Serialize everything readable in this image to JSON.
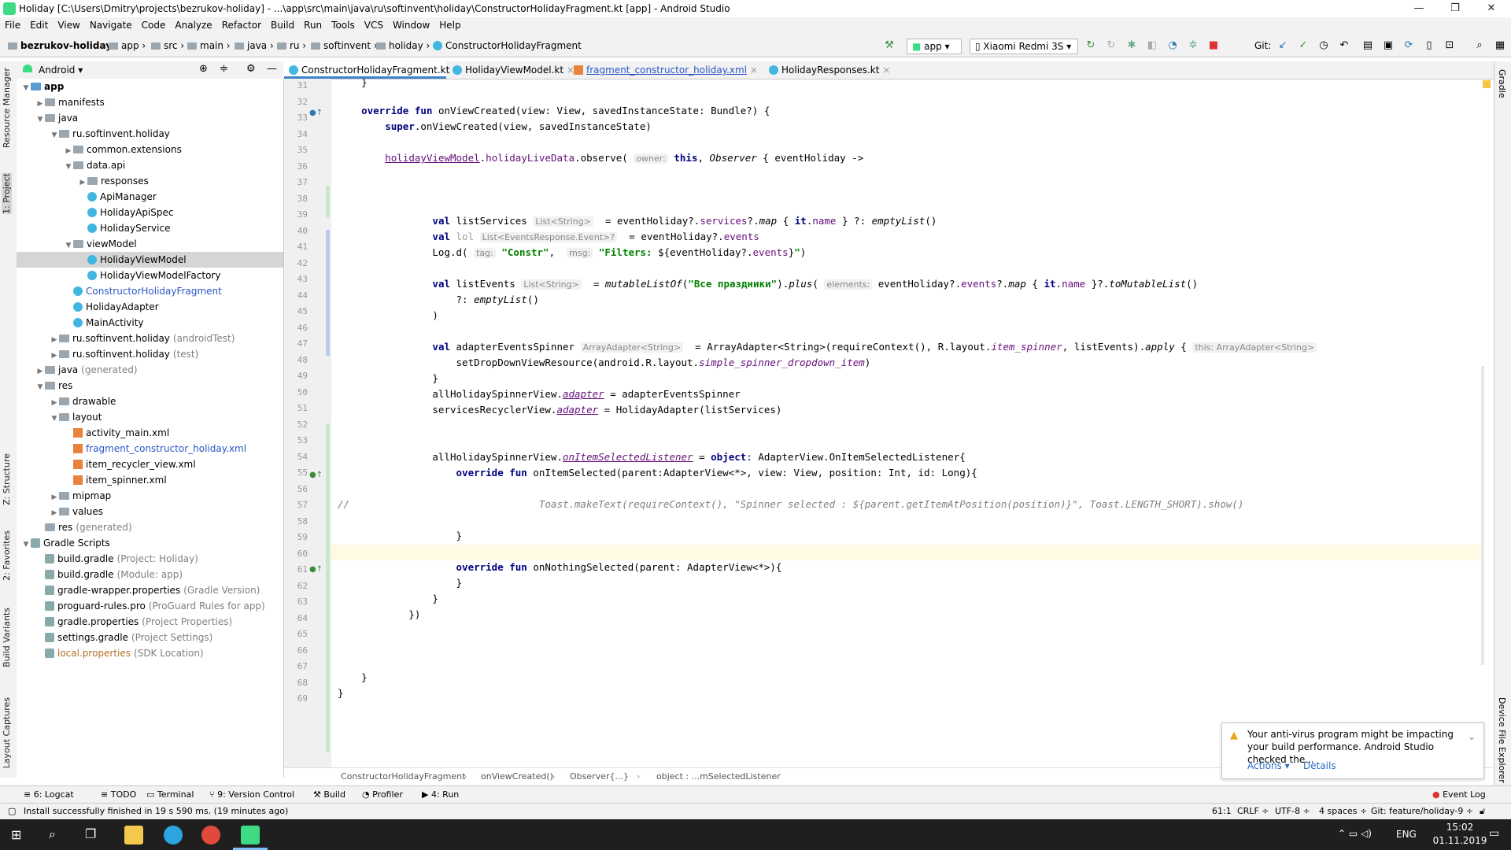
{
  "window": {
    "title": "Holiday [C:\\Users\\Dmitry\\projects\\bezrukov-holiday] - ...\\app\\src\\main\\java\\ru\\softinvent\\holiday\\ConstructorHolidayFragment.kt [app] - Android Studio",
    "minimize": "—",
    "maximize": "❐",
    "close": "✕"
  },
  "menu": [
    "File",
    "Edit",
    "View",
    "Navigate",
    "Code",
    "Analyze",
    "Refactor",
    "Build",
    "Run",
    "Tools",
    "VCS",
    "Window",
    "Help"
  ],
  "breadcrumbs": [
    "bezrukov-holiday",
    "app",
    "src",
    "main",
    "java",
    "ru",
    "softinvent",
    "holiday",
    "ConstructorHolidayFragment"
  ],
  "toolbar": {
    "run_config": "app",
    "device": "Xiaomi Redmi 3S",
    "git_label": "Git:"
  },
  "project_panel": {
    "view_mode": "Android"
  },
  "left_tabs": [
    "Resource Manager",
    "1: Project",
    "Z: Structure",
    "2: Favorites",
    "Build Variants",
    "Layout Captures"
  ],
  "right_tabs": [
    "Gradle",
    "Device File Explorer"
  ],
  "tree": [
    {
      "label": "app",
      "suffix": "",
      "icon": "folder"
    },
    {
      "label": "manifests",
      "suffix": "",
      "icon": "folder"
    },
    {
      "label": "java",
      "suffix": "",
      "icon": "folder"
    },
    {
      "label": "ru.softinvent.holiday",
      "suffix": "",
      "icon": "package"
    },
    {
      "label": "common.extensions",
      "suffix": "",
      "icon": "package"
    },
    {
      "label": "data.api",
      "suffix": "",
      "icon": "package"
    },
    {
      "label": "responses",
      "suffix": "",
      "icon": "package"
    },
    {
      "label": "ApiManager",
      "suffix": "",
      "icon": "kotlin-class"
    },
    {
      "label": "HolidayApiSpec",
      "suffix": "",
      "icon": "kotlin-class"
    },
    {
      "label": "HolidayService",
      "suffix": "",
      "icon": "kotlin-class"
    },
    {
      "label": "viewModel",
      "suffix": "",
      "icon": "package"
    },
    {
      "label": "HolidayViewModel",
      "suffix": "",
      "icon": "kotlin-class"
    },
    {
      "label": "HolidayViewModelFactory",
      "suffix": "",
      "icon": "kotlin-class"
    },
    {
      "label": "ConstructorHolidayFragment",
      "suffix": "",
      "icon": "kotlin-class"
    },
    {
      "label": "HolidayAdapter",
      "suffix": "",
      "icon": "kotlin-class"
    },
    {
      "label": "MainActivity",
      "suffix": "",
      "icon": "kotlin-class"
    },
    {
      "label": "ru.softinvent.holiday",
      "suffix": "(androidTest)",
      "icon": "package"
    },
    {
      "label": "ru.softinvent.holiday",
      "suffix": "(test)",
      "icon": "package"
    },
    {
      "label": "java",
      "suffix": "(generated)",
      "icon": "folder"
    },
    {
      "label": "res",
      "suffix": "",
      "icon": "folder"
    },
    {
      "label": "drawable",
      "suffix": "",
      "icon": "folder"
    },
    {
      "label": "layout",
      "suffix": "",
      "icon": "folder"
    },
    {
      "label": "activity_main.xml",
      "suffix": "",
      "icon": "xml"
    },
    {
      "label": "fragment_constructor_holiday.xml",
      "suffix": "",
      "icon": "xml"
    },
    {
      "label": "item_recycler_view.xml",
      "suffix": "",
      "icon": "xml"
    },
    {
      "label": "item_spinner.xml",
      "suffix": "",
      "icon": "xml"
    },
    {
      "label": "mipmap",
      "suffix": "",
      "icon": "folder"
    },
    {
      "label": "values",
      "suffix": "",
      "icon": "folder"
    },
    {
      "label": "res",
      "suffix": "(generated)",
      "icon": "folder"
    },
    {
      "label": "Gradle Scripts",
      "suffix": "",
      "icon": "gradle"
    },
    {
      "label": "build.gradle",
      "suffix": "(Project: Holiday)",
      "icon": "gradle"
    },
    {
      "label": "build.gradle",
      "suffix": "(Module: app)",
      "icon": "gradle"
    },
    {
      "label": "gradle-wrapper.properties",
      "suffix": "(Gradle Version)",
      "icon": "file"
    },
    {
      "label": "proguard-rules.pro",
      "suffix": "(ProGuard Rules for app)",
      "icon": "file"
    },
    {
      "label": "gradle.properties",
      "suffix": "(Project Properties)",
      "icon": "file"
    },
    {
      "label": "settings.gradle",
      "suffix": "(Project Settings)",
      "icon": "gradle"
    },
    {
      "label": "local.properties",
      "suffix": "(SDK Location)",
      "icon": "file"
    }
  ],
  "tabs": [
    "ConstructorHolidayFragment.kt",
    "HolidayViewModel.kt",
    "fragment_constructor_holiday.xml",
    "HolidayResponses.kt"
  ],
  "code_line_numbers": [
    "31",
    "32",
    "33",
    "34",
    "35",
    "36",
    "37",
    "38",
    "39",
    "40",
    "41",
    "42",
    "43",
    "44",
    "45",
    "46",
    "47",
    "48",
    "49",
    "50",
    "51",
    "52",
    "53",
    "54",
    "55",
    "56",
    "57",
    "58",
    "59",
    "60",
    "61",
    "62",
    "63",
    "64",
    "65",
    "66",
    "67",
    "68",
    "69"
  ],
  "hints": {
    "owner": "owner:",
    "list_string": "List<String>",
    "list_events": "List<EventsResponse.Event>?",
    "tag": "tag:",
    "msg": "msg:",
    "elements": "elements:",
    "array_adapter": "ArrayAdapter<String>",
    "this_array_adapter": "this: ArrayAdapter<String>"
  },
  "code_breadcrumb": [
    "ConstructorHolidayFragment",
    "onViewCreated()",
    "Observer{...}",
    "object : ...mSelectedListener"
  ],
  "notification": {
    "text": "Your anti-virus program might be impacting your build performance. Android Studio checked the...",
    "actions": "Actions ▾",
    "details": "Details"
  },
  "bottom_tools": [
    "6: Logcat",
    "TODO",
    "Terminal",
    "9: Version Control",
    "Build",
    "Profiler",
    "4: Run",
    "Event Log"
  ],
  "status": {
    "message": "Install successfully finished in 19 s 590 ms. (19 minutes ago)",
    "position": "61:1",
    "line_sep": "CRLF ÷",
    "encoding": "UTF-8 ÷",
    "indent": "4 spaces ÷",
    "git_branch": "Git: feature/holiday-9 ÷"
  },
  "taskbar": {
    "lang": "ENG",
    "time": "15:02",
    "date": "01.11.2019"
  }
}
